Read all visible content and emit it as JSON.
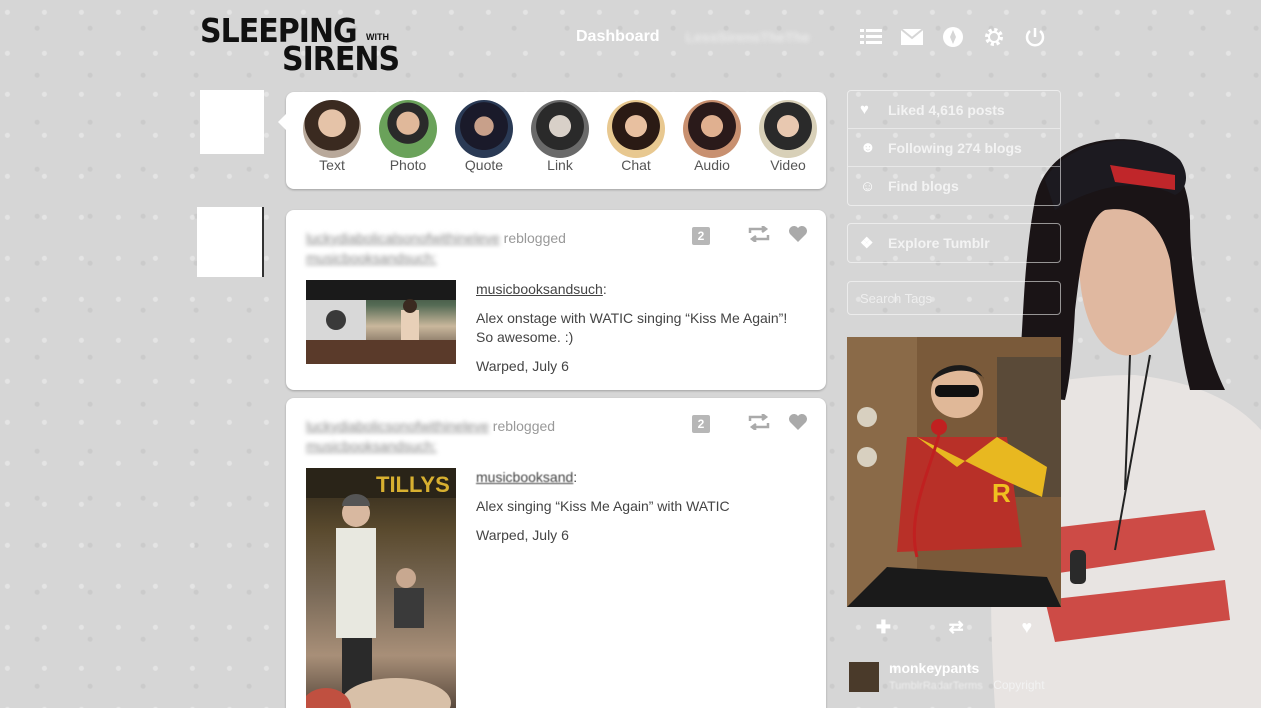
{
  "logo": {
    "line1": "SLEEPING",
    "with": "WITH",
    "line2": "SIRENS"
  },
  "nav": {
    "dashboard": "Dashboard",
    "blurred_user": "LessSirensTheThe",
    "icons": [
      "list-icon",
      "mail-icon",
      "compass-icon",
      "gear-icon",
      "power-icon"
    ]
  },
  "post_types": [
    {
      "label": "Text",
      "color": "#b8a89a"
    },
    {
      "label": "Photo",
      "color": "#6aa25a"
    },
    {
      "label": "Quote",
      "color": "#2a3a55"
    },
    {
      "label": "Link",
      "color": "#6a6a6a"
    },
    {
      "label": "Chat",
      "color": "#c89a6a"
    },
    {
      "label": "Audio",
      "color": "#a07058"
    },
    {
      "label": "Video",
      "color": "#8a7a6a"
    }
  ],
  "posts": [
    {
      "reblogger": "luckydiabolicalsonofwithineleve",
      "action": "reblogged",
      "source": "musicbooksandsuch:",
      "notes": "2",
      "caption_source": "musicbooksandsuch",
      "caption": "Alex onstage with WATIC singing “Kiss Me Again”! So awesome. :)",
      "location": "Warped, July 6"
    },
    {
      "reblogger": "luckydiabolicsonofwithineleve",
      "action": "reblogged",
      "source": "musicbooksandsuch:",
      "notes": "2",
      "caption_source": "musicbooksand",
      "caption": "Alex singing “Kiss Me Again” with WATIC",
      "location": "Warped, July 6"
    }
  ],
  "sidebar": {
    "liked": "Liked 4,616 posts",
    "following": "Following 274 blogs",
    "find": "Find blogs",
    "explore": "Explore Tumblr",
    "search_placeholder": "Search Tags"
  },
  "spotlight": {
    "username": "monkeypants",
    "subtitle": "TumblrRadarTerms",
    "copyright": "Copyright"
  }
}
